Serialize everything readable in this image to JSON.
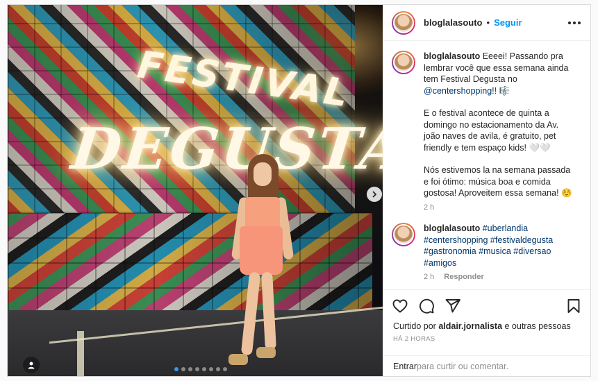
{
  "post": {
    "photo": {
      "sign_small": "FESTIVAL",
      "sign_large": "DEGUSTA",
      "carousel_total": 8,
      "carousel_active": 1
    },
    "header": {
      "username": "bloglalasouto",
      "separator": "•",
      "follow_label": "Seguir"
    },
    "caption": {
      "username": "bloglalasouto",
      "p1_text": " Eeeei! Passando pra lembrar você que essa semana ainda tem Festival Degusta no ",
      "p1_mention": "@centershopping",
      "p1_end": "!! 🎼",
      "p2": "E o festival acontece de quinta a domingo no estacionamento da Av. joão naves de avila, é gratuito, pet friendly e tem espaço kids! 🤍🤍",
      "p3": "Nós estivemos la na semana passada e foi ótimo: música boa e comida gostosa! Aproveitem essa semana! ☺️",
      "time": "2 h"
    },
    "comment": {
      "username": "bloglalasouto",
      "tags": [
        "#uberlandia",
        "#centershopping",
        "#festivaldegusta",
        "#gastronomia",
        "#musica",
        "#diversao",
        "#amigos"
      ],
      "time": "2 h",
      "reply_label": "Responder"
    },
    "likes": {
      "prefix": "Curtido por ",
      "user": "aldair.jornalista",
      "suffix": " e outras pessoas"
    },
    "timestamp": "HÁ 2 HORAS",
    "login": {
      "enter_label": "Entrar",
      "rest": " para curtir ou comentar."
    }
  },
  "colors": {
    "accent": "#0095f6",
    "link": "#00376b",
    "muted": "#8e8e8e",
    "text": "#262626"
  },
  "icons": [
    "heart-icon",
    "comment-icon",
    "share-icon",
    "bookmark-icon",
    "more-icon",
    "chevron-right-icon",
    "user-tag-icon"
  ]
}
